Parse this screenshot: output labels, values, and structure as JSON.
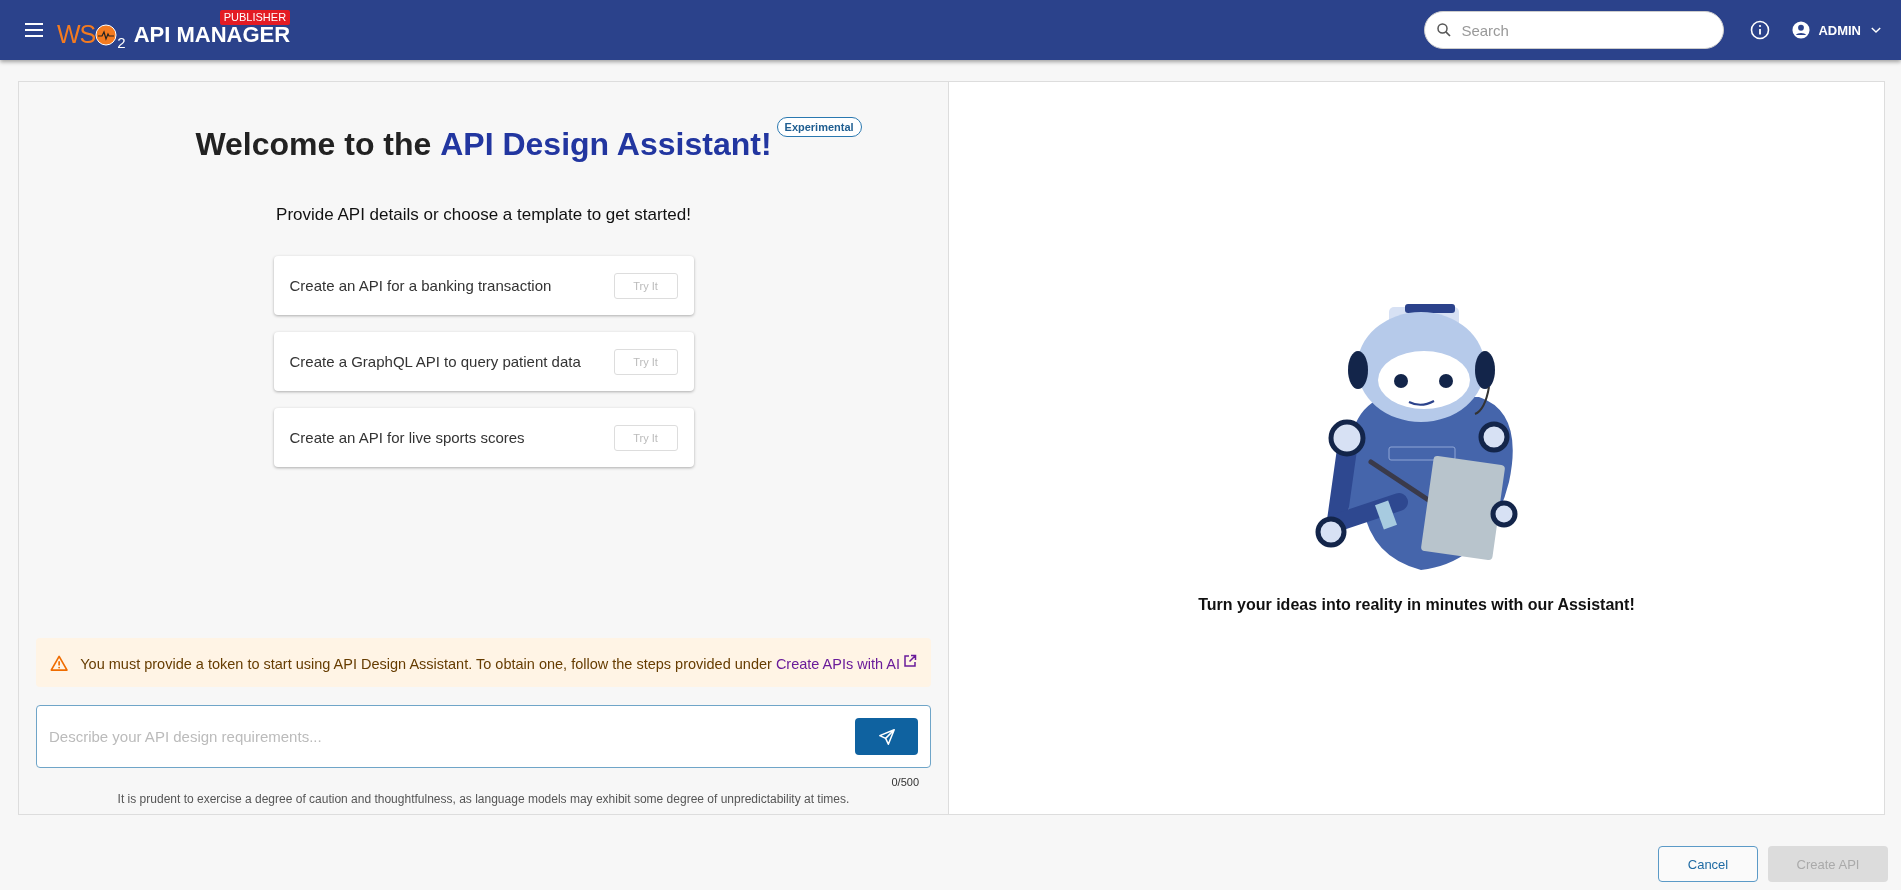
{
  "header": {
    "logo": {
      "letters": "WS",
      "subscript": "2",
      "product": "API MANAGER",
      "badge": "PUBLISHER"
    },
    "search": {
      "placeholder": "Search"
    },
    "user": {
      "name": "ADMIN"
    }
  },
  "assistant": {
    "title_lead": "Welcome to the ",
    "title_highlight": "API Design Assistant!",
    "badge": "Experimental",
    "subtitle": "Provide API details or choose a template to get started!",
    "templates": [
      {
        "text": "Create an API for a banking transaction",
        "action": "Try It",
        "disabled": true
      },
      {
        "text": "Create a GraphQL API to query patient data",
        "action": "Try It",
        "disabled": true
      },
      {
        "text": "Create an API for live sports scores",
        "action": "Try It",
        "disabled": true
      }
    ],
    "warning": {
      "text": "You must provide a token to start using API Design Assistant. To obtain one, follow the steps provided under ",
      "link": "Create APIs with AI"
    },
    "input": {
      "placeholder": "Describe your API design requirements...",
      "counter": "0/500"
    },
    "disclaimer": "It is prudent to exercise a degree of caution and thoughtfulness, as language models may exhibit some degree of unpredictability at times."
  },
  "preview": {
    "caption": "Turn your ideas into reality in minutes with our Assistant!"
  },
  "actions": [
    {
      "label": "Cancel",
      "kind": "outlined",
      "disabled": false
    },
    {
      "label": "Create API",
      "kind": "contained",
      "disabled": true
    }
  ]
}
